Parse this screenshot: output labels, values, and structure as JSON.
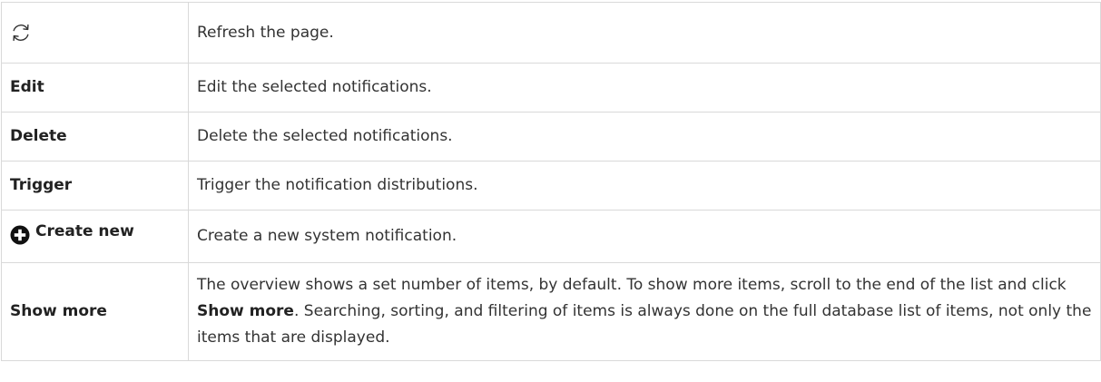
{
  "rows": [
    {
      "icon": "refresh-icon",
      "term": "",
      "description": "Refresh the page."
    },
    {
      "term": "Edit",
      "description": "Edit the selected notifications."
    },
    {
      "term": "Delete",
      "description": "Delete the selected notifications."
    },
    {
      "term": "Trigger",
      "description": "Trigger the notification distributions."
    },
    {
      "icon": "plus-circle-icon",
      "term": "Create new",
      "description": "Create a new system notification."
    },
    {
      "term": "Show more",
      "description_parts": {
        "before": "The overview shows a set number of items, by default. To show more items, scroll to the end of the list and click ",
        "emphasis": "Show more",
        "after": ". Searching, sorting, and filtering of items is always done on the full database list of items, not only the items that are displayed."
      }
    }
  ]
}
